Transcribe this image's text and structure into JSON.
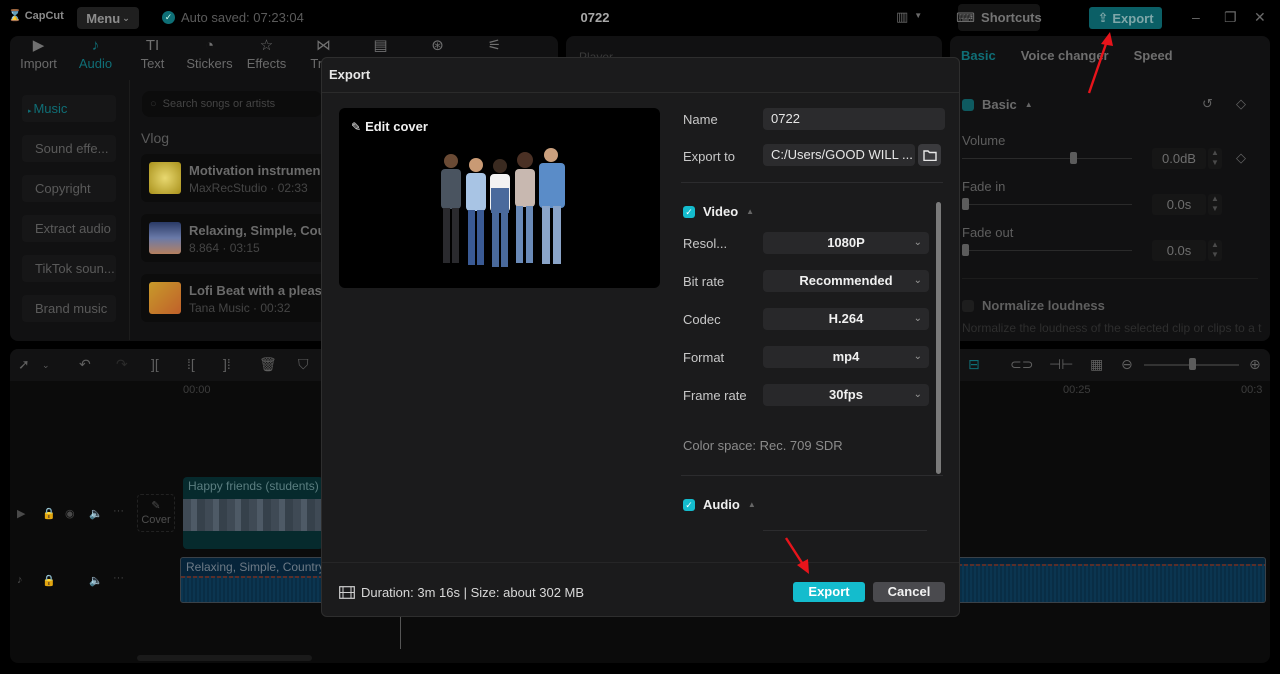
{
  "app": {
    "logo": "CapCut",
    "menu_label": "Menu",
    "autosave": "Auto saved: 07:23:04",
    "project_title": "0722",
    "shortcuts_label": "Shortcuts",
    "export_label": "Export"
  },
  "toolbar_tabs": [
    {
      "label": "Import",
      "icon": "import-icon"
    },
    {
      "label": "Audio",
      "icon": "audio-icon",
      "active": true
    },
    {
      "label": "Text",
      "icon": "text-icon"
    },
    {
      "label": "Stickers",
      "icon": "stickers-icon"
    },
    {
      "label": "Effects",
      "icon": "effects-icon"
    },
    {
      "label": "Tran",
      "icon": "transitions-icon"
    },
    {
      "label": "",
      "icon": "captions-icon"
    },
    {
      "label": "",
      "icon": "filters-icon"
    },
    {
      "label": "",
      "icon": "adjustment-icon"
    }
  ],
  "audio_sidebar": [
    {
      "label": "Music",
      "active": true
    },
    {
      "label": "Sound effe..."
    },
    {
      "label": "Copyright"
    },
    {
      "label": "Extract audio"
    },
    {
      "label": "TikTok soun..."
    },
    {
      "label": "Brand music"
    }
  ],
  "music": {
    "search_placeholder": "Search songs or artists",
    "category": "Vlog",
    "tracks": [
      {
        "title": "Motivation instrumen",
        "meta": "MaxRecStudio · 02:33"
      },
      {
        "title": "Relaxing, Simple, Cou",
        "meta": "8.864 · 03:15"
      },
      {
        "title": "Lofi Beat with a pleasa",
        "meta": "Tana Music · 00:32"
      }
    ]
  },
  "player_label": "Player",
  "right_panel": {
    "tabs": [
      "Basic",
      "Voice changer",
      "Speed"
    ],
    "section": "Basic",
    "volume_label": "Volume",
    "volume_value": "0.0dB",
    "volume_level": 0.65,
    "fade_in_label": "Fade in",
    "fade_in_value": "0.0s",
    "fade_out_label": "Fade out",
    "fade_out_value": "0.0s",
    "normalize_label": "Normalize loudness",
    "normalize_desc": "Normalize the loudness of the selected clip or clips to a target level"
  },
  "timeline": {
    "ruler": [
      "00:00",
      "00:25",
      "00:3"
    ],
    "zoom_level": 0.5,
    "cover_label": "Cover",
    "video_clip": "Happy friends (students)",
    "audio_clip": "Relaxing, Simple, Country"
  },
  "export_dialog": {
    "title": "Export",
    "edit_cover": "Edit cover",
    "name_label": "Name",
    "name_value": "0722",
    "export_to_label": "Export to",
    "export_to_value": "C:/Users/GOOD WILL ...",
    "video_section": "Video",
    "video_fields": [
      {
        "label": "Resol...",
        "value": "1080P"
      },
      {
        "label": "Bit rate",
        "value": "Recommended"
      },
      {
        "label": "Codec",
        "value": "H.264"
      },
      {
        "label": "Format",
        "value": "mp4"
      },
      {
        "label": "Frame rate",
        "value": "30fps"
      }
    ],
    "color_space": "Color space: Rec. 709 SDR",
    "audio_section": "Audio",
    "footer_info": "Duration: 3m 16s | Size: about 302 MB",
    "export_button": "Export",
    "cancel_button": "Cancel"
  },
  "colors": {
    "accent": "#14bccd",
    "accent_dim": "#0f6e76",
    "annotation_arrow": "#e8141b"
  }
}
